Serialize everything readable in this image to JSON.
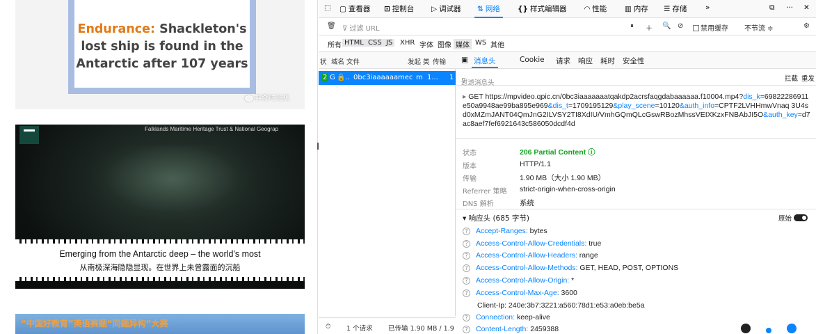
{
  "article": {
    "title_accent": "Endurance:",
    "title_rest": " Shackleton's lost ship is found in the Antarctic after 107 years",
    "watermark": "神奇时光机",
    "video_credit": "Falklands Maritime Heritage Trust & National Geograp",
    "subtitle_en": "Emerging from the Antarctic deep – the world's most",
    "subtitle_zh": "从南极深海隐隐显现。在世界上未曾露面的沉船",
    "banner": "“中国好教育”英语赛题“同题异构”大赛"
  },
  "devtools": {
    "toolbar": {
      "inspector": "查看器",
      "console": "控制台",
      "debugger": "调试器",
      "network": "网络",
      "style_editor": "样式编辑器",
      "performance": "性能",
      "memory": "内存",
      "storage": "存储",
      "more": "»"
    },
    "filter": {
      "placeholder": "过滤 URL",
      "disable_cache": "禁用缓存",
      "throttle": "不节流 ≑"
    },
    "types": [
      "所有",
      "HTML",
      "CSS",
      "JS",
      "XHR",
      "字体",
      "图像",
      "媒体",
      "WS",
      "其他"
    ],
    "list_head": {
      "status": "状",
      "domain": "域名",
      "file": "文件",
      "initiator": "发起",
      "type": "类",
      "transferred": "传输"
    },
    "request_row": {
      "status": "2",
      "method": "G",
      "domain": "..",
      "file": "0bc3iaaaaaa",
      "initiator": "mec",
      "type": "m",
      "size": "1...",
      "extra": "1"
    },
    "status_bar": {
      "requests": "1 个请求",
      "transferred": "已传输 1.90 MB / 1.9"
    },
    "detail_tabs": [
      "消息头",
      "Cookie",
      "请求",
      "响应",
      "耗时",
      "安全性"
    ],
    "header_filter": {
      "placeholder": "过滤消息头",
      "block": "拦截",
      "resend": "重发"
    },
    "request_line": {
      "method": "GET",
      "url_base": "https://mpvideo.qpic.cn/0bc3iaaaaaaatqakdp2acrsfaqgdabaaaaaa.f10004.mp4?",
      "k1": "dis_k",
      "v1": "=69822286911e50a9948ae99ba895e969",
      "k2": "&dis_t",
      "v2": "=1709195129",
      "k3": "&play_scene",
      "v3": "=10120",
      "k4": "&auth_info",
      "v4": "=CPTF2LVHHmwVnaq 3U4sd0xMZmJANT04QmJnG2ILVSY2TI8XdIU/VmhGQmQLcGswRBozMhssVEIXKzxFNBAbJI5O",
      "k5": "&auth_key",
      "v5": "=d7ac8aef7fef6921643c586050dcdf4d"
    },
    "general": {
      "status_label": "状态",
      "status_value": "206 Partial Content ⓘ",
      "version_label": "版本",
      "version_value": "HTTP/1.1",
      "transferred_label": "传输",
      "transferred_value": "1.90 MB（大小 1.90 MB）",
      "referrer_label": "Referrer 策略",
      "referrer_value": "strict-origin-when-cross-origin",
      "dns_label": "DNS 解析",
      "dns_value": "系统"
    },
    "response_headers": {
      "title": "▾ 响应头 (685 字节)",
      "raw_label": "原始",
      "items": [
        {
          "name": "Accept-Ranges:",
          "value": " bytes"
        },
        {
          "name": "Access-Control-Allow-Credentials:",
          "value": " true"
        },
        {
          "name": "Access-Control-Allow-Headers:",
          "value": " range"
        },
        {
          "name": "Access-Control-Allow-Methods:",
          "value": " GET, HEAD, POST, OPTIONS"
        },
        {
          "name": "Access-Control-Allow-Origin:",
          "value": " *"
        },
        {
          "name": "Access-Control-Max-Age:",
          "value": " 3600"
        },
        {
          "name": "Client-Ip:",
          "value": " 240e:3b7:3221:a560:78d1:e53:a0eb:be5a"
        },
        {
          "name": "Connection:",
          "value": " keep-alive"
        },
        {
          "name": "Content-Length:",
          "value": " 2459388"
        }
      ]
    }
  },
  "colors": {
    "accent": "#0a84ff",
    "status_ok": "#12a320",
    "title_accent": "#e07b18"
  }
}
